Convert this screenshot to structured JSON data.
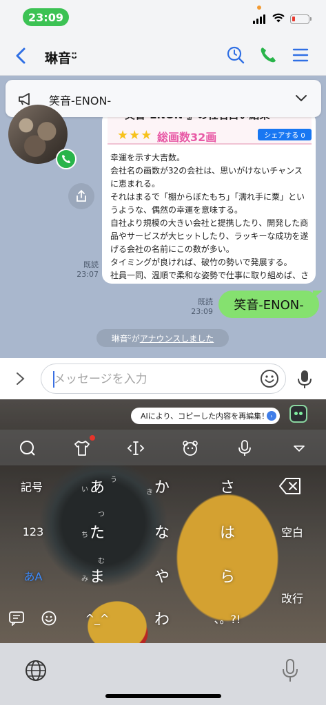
{
  "status_bar": {
    "time": "23:09"
  },
  "header": {
    "title": "琳音ᵕ̈",
    "back_label": "<"
  },
  "announcement": {
    "text": "笑音-ENON-"
  },
  "messages": {
    "received": {
      "result_title": "『笑音-ENON-』の社名占い結果",
      "stars": "★★★",
      "stroke_count": "総画数32画",
      "share_button": "シェアする 0",
      "body_lines": [
        "幸運を示す大吉数。",
        "会社名の画数が32の会社は、思いがけないチャンスに恵まれる。",
        "それはまるで「棚からぼたもち」「濡れ手に粟」というような、偶然の幸運を意味する。",
        "自社より規模の大きい会社と提携したり、開発した商品やサービスが大ヒットしたり、ラッキーな成功を遂げる会社の名前にこの数が多い。",
        "タイミングが良ければ、破竹の勢いで発展する。",
        "社員一同、温順で柔和な姿勢で仕事に取り組めば、さらに徳に恵まれ繁栄する。"
      ],
      "read_label": "既読",
      "time": "23:07"
    },
    "sent": {
      "text": "笑音-ENON-",
      "read_label": "既読",
      "time": "23:09"
    },
    "system": {
      "name": "琳音ᵕ̈が",
      "link": "アナウンスしました"
    }
  },
  "input": {
    "placeholder": "メッセージを入力"
  },
  "keyboard": {
    "ai_banner": "AIにより、コピーした内容を再編集！",
    "keys": {
      "symbols": "記号",
      "a": "あ",
      "ka": "か",
      "sa": "さ",
      "num": "123",
      "ta": "た",
      "na": "な",
      "ha": "は",
      "space": "空白",
      "mode": "あA",
      "ma": "ま",
      "ya": "や",
      "ra": "ら",
      "enter": "改行",
      "kaomoji": "^_^",
      "wa": "わ",
      "punct": "、。?!"
    },
    "hints": {
      "i": "い",
      "u": "う",
      "ki": "き",
      "chi": "ち",
      "tsu": "つ",
      "mi": "み",
      "mu": "む"
    }
  },
  "colors": {
    "accent": "#3a6fe2",
    "line_green": "#28b44a",
    "sent_bubble": "#85e16f",
    "chat_bg": "#a9b7cd"
  }
}
